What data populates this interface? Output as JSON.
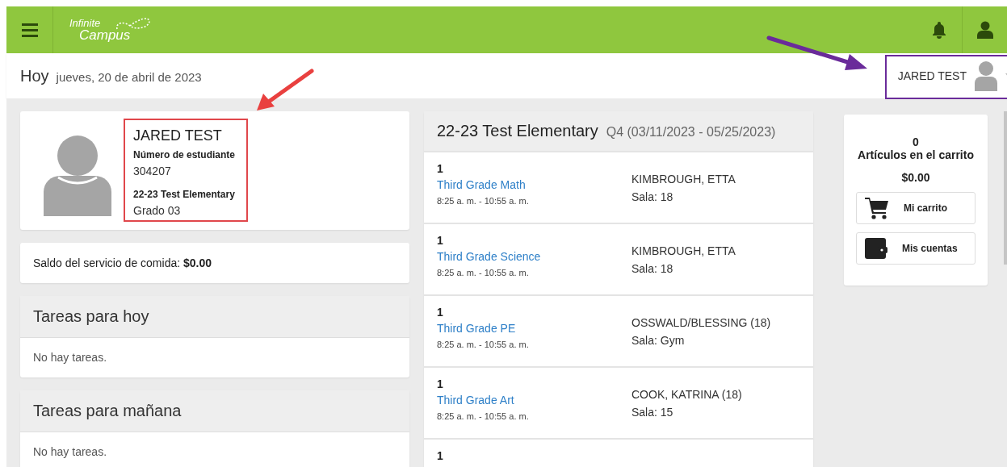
{
  "header": {
    "logo_top": "Infinite",
    "logo_bottom": "Campus"
  },
  "subheader": {
    "title": "Hoy",
    "date": "jueves, 20 de abril de 2023",
    "user_name": "JARED TEST"
  },
  "student": {
    "name": "JARED TEST",
    "id_label": "Número de estudiante",
    "id": "304207",
    "school": "22-23 Test Elementary",
    "grade": "Grado 03"
  },
  "food_balance": {
    "label": "Saldo del servicio de comida:",
    "amount": "$0.00"
  },
  "task_panels": [
    {
      "title": "Tareas para hoy",
      "message": "No hay tareas."
    },
    {
      "title": "Tareas para mañana",
      "message": "No hay tareas."
    }
  ],
  "schedule": {
    "school": "22-23 Test Elementary",
    "term": "Q4 (03/11/2023 - 05/25/2023)",
    "rows": [
      {
        "period": "1",
        "course": "Third Grade Math",
        "time": "8:25 a. m. - 10:55 a. m.",
        "teacher": "KIMBROUGH, ETTA",
        "room": "Sala: 18"
      },
      {
        "period": "1",
        "course": "Third Grade Science",
        "time": "8:25 a. m. - 10:55 a. m.",
        "teacher": "KIMBROUGH, ETTA",
        "room": "Sala: 18"
      },
      {
        "period": "1",
        "course": "Third Grade PE",
        "time": "8:25 a. m. - 10:55 a. m.",
        "teacher": "OSSWALD/BLESSING (18)",
        "room": "Sala: Gym"
      },
      {
        "period": "1",
        "course": "Third Grade Art",
        "time": "8:25 a. m. - 10:55 a. m.",
        "teacher": "COOK, KATRINA (18)",
        "room": "Sala: 15"
      },
      {
        "period": "1"
      }
    ]
  },
  "cart": {
    "count": "0",
    "label": "Artículos en el carrito",
    "total": "$0.00",
    "buttons": [
      {
        "kind": "cart",
        "label": "Mi carrito"
      },
      {
        "kind": "wallet",
        "label": "Mis cuentas"
      }
    ]
  }
}
